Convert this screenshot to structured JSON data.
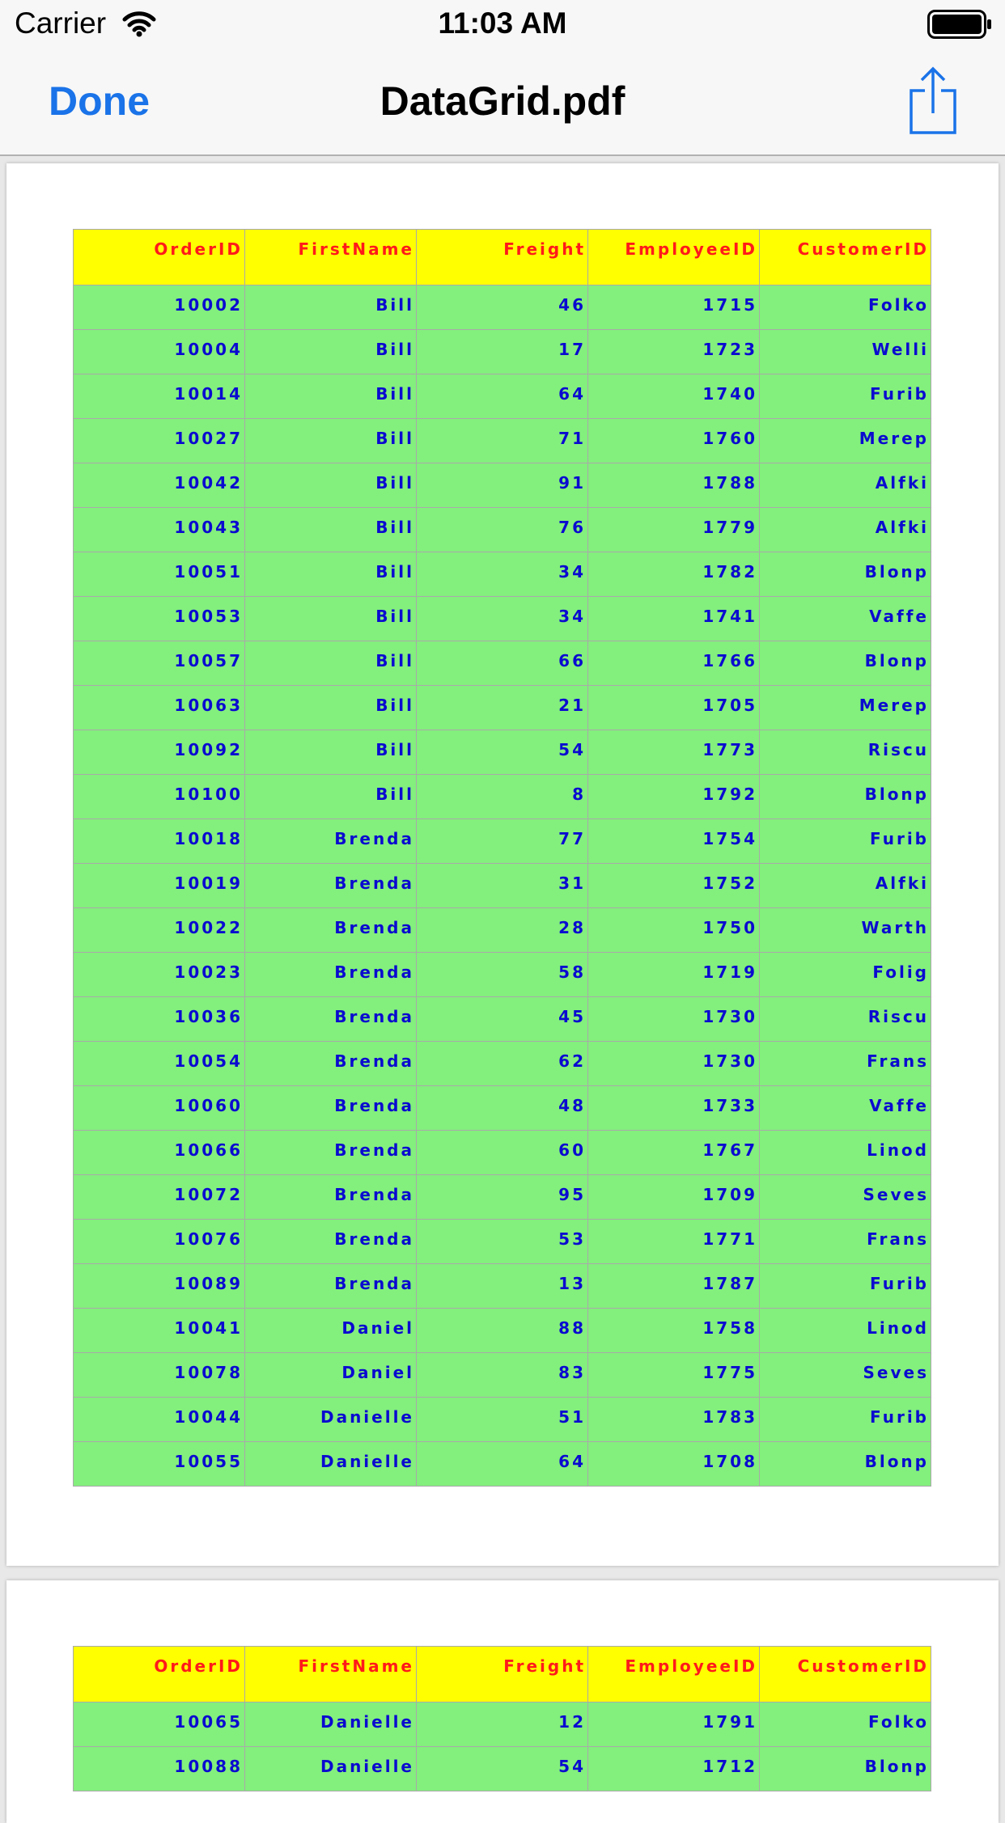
{
  "status_bar": {
    "carrier": "Carrier",
    "time": "11:03 AM"
  },
  "nav_bar": {
    "done_label": "Done",
    "title": "DataGrid.pdf"
  },
  "colors": {
    "header_bg": "#ffff00",
    "header_text": "#ff1a1a",
    "cell_bg": "#83ef7d",
    "cell_text": "#0a0ad0",
    "done_button": "#1a73e8"
  },
  "icons": {
    "wifi": "wifi-icon",
    "battery": "battery-icon",
    "share": "share-icon"
  },
  "table": {
    "columns": [
      "OrderID",
      "FirstName",
      "Freight",
      "EmployeeID",
      "CustomerID"
    ]
  },
  "pages": [
    {
      "rows": [
        [
          "10002",
          "Bill",
          "46",
          "1715",
          "Folko"
        ],
        [
          "10004",
          "Bill",
          "17",
          "1723",
          "Welli"
        ],
        [
          "10014",
          "Bill",
          "64",
          "1740",
          "Furib"
        ],
        [
          "10027",
          "Bill",
          "71",
          "1760",
          "Merep"
        ],
        [
          "10042",
          "Bill",
          "91",
          "1788",
          "Alfki"
        ],
        [
          "10043",
          "Bill",
          "76",
          "1779",
          "Alfki"
        ],
        [
          "10051",
          "Bill",
          "34",
          "1782",
          "Blonp"
        ],
        [
          "10053",
          "Bill",
          "34",
          "1741",
          "Vaffe"
        ],
        [
          "10057",
          "Bill",
          "66",
          "1766",
          "Blonp"
        ],
        [
          "10063",
          "Bill",
          "21",
          "1705",
          "Merep"
        ],
        [
          "10092",
          "Bill",
          "54",
          "1773",
          "Riscu"
        ],
        [
          "10100",
          "Bill",
          "8",
          "1792",
          "Blonp"
        ],
        [
          "10018",
          "Brenda",
          "77",
          "1754",
          "Furib"
        ],
        [
          "10019",
          "Brenda",
          "31",
          "1752",
          "Alfki"
        ],
        [
          "10022",
          "Brenda",
          "28",
          "1750",
          "Warth"
        ],
        [
          "10023",
          "Brenda",
          "58",
          "1719",
          "Folig"
        ],
        [
          "10036",
          "Brenda",
          "45",
          "1730",
          "Riscu"
        ],
        [
          "10054",
          "Brenda",
          "62",
          "1730",
          "Frans"
        ],
        [
          "10060",
          "Brenda",
          "48",
          "1733",
          "Vaffe"
        ],
        [
          "10066",
          "Brenda",
          "60",
          "1767",
          "Linod"
        ],
        [
          "10072",
          "Brenda",
          "95",
          "1709",
          "Seves"
        ],
        [
          "10076",
          "Brenda",
          "53",
          "1771",
          "Frans"
        ],
        [
          "10089",
          "Brenda",
          "13",
          "1787",
          "Furib"
        ],
        [
          "10041",
          "Daniel",
          "88",
          "1758",
          "Linod"
        ],
        [
          "10078",
          "Daniel",
          "83",
          "1775",
          "Seves"
        ],
        [
          "10044",
          "Danielle",
          "51",
          "1783",
          "Furib"
        ],
        [
          "10055",
          "Danielle",
          "64",
          "1708",
          "Blonp"
        ]
      ]
    },
    {
      "rows": [
        [
          "10065",
          "Danielle",
          "12",
          "1791",
          "Folko"
        ],
        [
          "10088",
          "Danielle",
          "54",
          "1712",
          "Blonp"
        ]
      ]
    }
  ]
}
